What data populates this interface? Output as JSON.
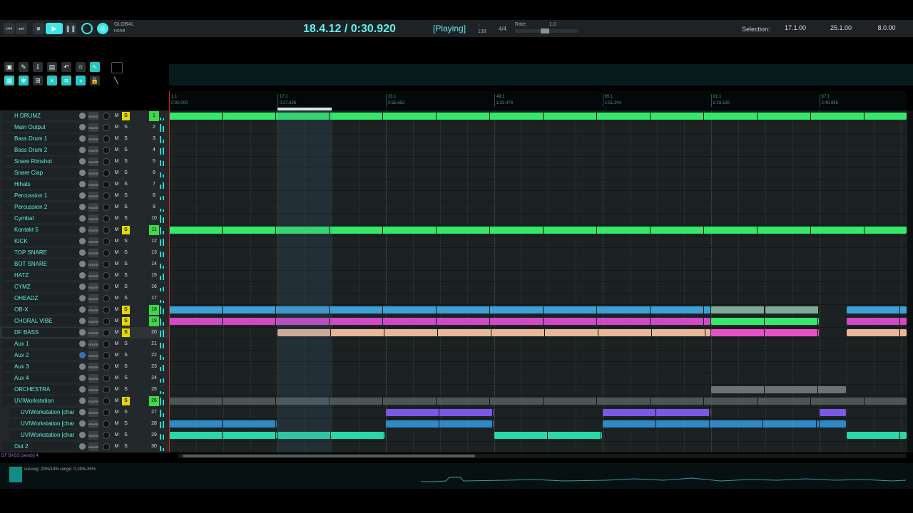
{
  "transport": {
    "global_label": "GLOBAL",
    "global_value": "none",
    "clock": "18.4.12 / 0:30.920",
    "play_state": "[Playing]",
    "tempo": "138",
    "meter": "4/4",
    "rate_label": "Rate:",
    "rate_value": "1.0",
    "selection_label": "Selection:",
    "selection_start": "17.1.00",
    "selection_end": "25.1.00",
    "selection_length": "8.0.00",
    "accent_color": "#3ee6e6"
  },
  "ruler": {
    "marks": [
      {
        "bar": "1.1",
        "time": "0:00.000",
        "beat": 1
      },
      {
        "bar": "17.1",
        "time": "0:27.826",
        "beat": 17
      },
      {
        "bar": "33.1",
        "time": "0:55.652",
        "beat": 33
      },
      {
        "bar": "49.1",
        "time": "1:23.478",
        "beat": 49
      },
      {
        "bar": "65.1",
        "time": "1:51.304",
        "beat": 65
      },
      {
        "bar": "81.1",
        "time": "2:19.130",
        "beat": 81
      },
      {
        "bar": "97.1",
        "time": "2:46.956",
        "beat": 97
      }
    ],
    "total_bars": 110,
    "loop_start_bar": 17,
    "loop_end_bar": 25
  },
  "tracks": [
    {
      "num": "1",
      "name": "H DRUMZ",
      "solo": true,
      "folder": true
    },
    {
      "num": "2",
      "name": "Main Output"
    },
    {
      "num": "3",
      "name": "Bass Drum 1"
    },
    {
      "num": "4",
      "name": "Bass Drum 2"
    },
    {
      "num": "5",
      "name": "Snare Rimshot"
    },
    {
      "num": "6",
      "name": "Snare Clap"
    },
    {
      "num": "7",
      "name": "Hihats"
    },
    {
      "num": "8",
      "name": "Percussion 1"
    },
    {
      "num": "9",
      "name": "Percussion 2"
    },
    {
      "num": "10",
      "name": "Cymbal"
    },
    {
      "num": "11",
      "name": "Kontakt 5",
      "solo": true,
      "folder": true
    },
    {
      "num": "12",
      "name": "KICK"
    },
    {
      "num": "13",
      "name": "TOP SNARE"
    },
    {
      "num": "14",
      "name": "BOT SNARE"
    },
    {
      "num": "15",
      "name": "HATZ"
    },
    {
      "num": "16",
      "name": "CYMZ"
    },
    {
      "num": "17",
      "name": "OHEADZ"
    },
    {
      "num": "18",
      "name": "OB-X",
      "solo": true,
      "folder": true
    },
    {
      "num": "19",
      "name": "CHORAL VIBE",
      "solo": true,
      "folder": true
    },
    {
      "num": "20",
      "name": "DF BASS",
      "solo": true,
      "selected": true
    },
    {
      "num": "21",
      "name": "Aux 1"
    },
    {
      "num": "22",
      "name": "Aux 2",
      "blue_knob": true
    },
    {
      "num": "23",
      "name": "Aux 3"
    },
    {
      "num": "24",
      "name": "Aux 4"
    },
    {
      "num": "25",
      "name": "ORCHESTRA"
    },
    {
      "num": "26",
      "name": "UVIWorkstation",
      "solo": true,
      "folder": true
    },
    {
      "num": "27",
      "name": "UVIWorkstation [char",
      "sub": true
    },
    {
      "num": "28",
      "name": "UVIWorkstation [char",
      "sub": true
    },
    {
      "num": "29",
      "name": "UVIWorkstation [char",
      "sub": true
    },
    {
      "num": "30",
      "name": "Out 2"
    }
  ],
  "track_controls": {
    "mute_label": "M",
    "solo_label": "S",
    "route_label": "ROUTE"
  },
  "clips": [
    {
      "lane": 0,
      "start": 1,
      "end": 110,
      "color": "#34e86a"
    },
    {
      "lane": 10,
      "start": 1,
      "end": 110,
      "color": "#34e86a"
    },
    {
      "lane": 17,
      "start": 1,
      "end": 81,
      "color": "#3fa0d8"
    },
    {
      "lane": 17,
      "start": 81,
      "end": 89,
      "color": "#7faa98"
    },
    {
      "lane": 17,
      "start": 89,
      "end": 97,
      "color": "#7faa98"
    },
    {
      "lane": 17,
      "start": 101,
      "end": 110,
      "color": "#3fa0d8"
    },
    {
      "lane": 18,
      "start": 1,
      "end": 81,
      "color": "#d04ac8"
    },
    {
      "lane": 18,
      "start": 81,
      "end": 97,
      "color": "#34e86a"
    },
    {
      "lane": 18,
      "start": 101,
      "end": 110,
      "color": "#d04ac8"
    },
    {
      "lane": 19,
      "start": 17,
      "end": 81,
      "color": "#e8b89a"
    },
    {
      "lane": 19,
      "start": 81,
      "end": 97,
      "color": "#e850c8"
    },
    {
      "lane": 19,
      "start": 101,
      "end": 110,
      "color": "#e8b89a"
    },
    {
      "lane": 24,
      "start": 81,
      "end": 101,
      "color": "#6b7474"
    },
    {
      "lane": 25,
      "start": 1,
      "end": 110,
      "color": "#4d5656"
    },
    {
      "lane": 26,
      "start": 33,
      "end": 49,
      "color": "#7b58e8"
    },
    {
      "lane": 26,
      "start": 65,
      "end": 81,
      "color": "#7b58e8"
    },
    {
      "lane": 26,
      "start": 97,
      "end": 101,
      "color": "#7b58e8"
    },
    {
      "lane": 27,
      "start": 1,
      "end": 17,
      "color": "#2f88c8"
    },
    {
      "lane": 27,
      "start": 33,
      "end": 49,
      "color": "#2f88c8"
    },
    {
      "lane": 27,
      "start": 65,
      "end": 97,
      "color": "#2f88c8"
    },
    {
      "lane": 27,
      "start": 97,
      "end": 101,
      "color": "#2f88c8"
    },
    {
      "lane": 28,
      "start": 1,
      "end": 17,
      "color": "#2ad8a8"
    },
    {
      "lane": 28,
      "start": 17,
      "end": 33,
      "color": "#2ad8a8"
    },
    {
      "lane": 28,
      "start": 49,
      "end": 65,
      "color": "#2ad8a8"
    },
    {
      "lane": 28,
      "start": 101,
      "end": 110,
      "color": "#2ad8a8"
    }
  ],
  "status": {
    "selected_info": "DF BASS [sends] 4",
    "cpu_text": "cur/avg: 20%/14%   range: 0.19%-35%"
  }
}
